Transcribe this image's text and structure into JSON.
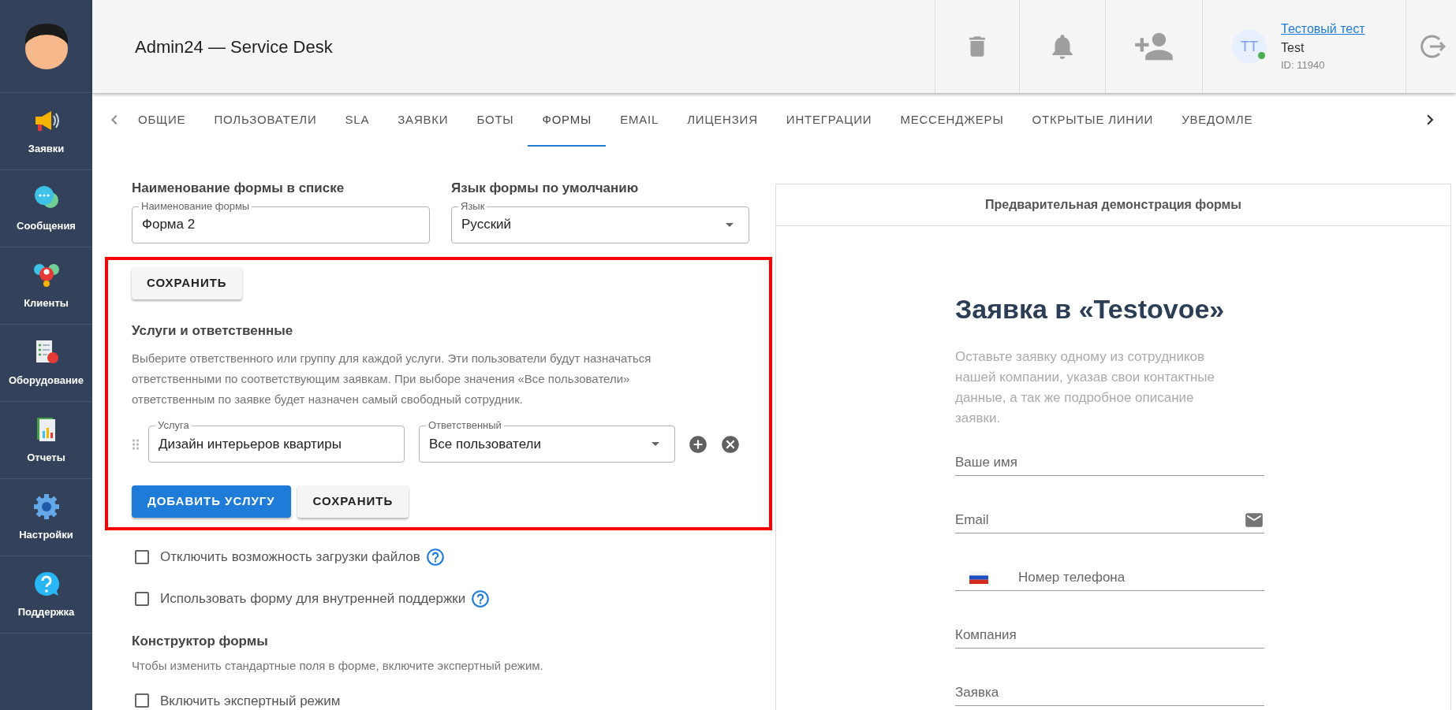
{
  "sidebar": {
    "items": [
      {
        "kind": "megaphone",
        "label": "Заявки"
      },
      {
        "kind": "chat",
        "label": "Сообщения"
      },
      {
        "kind": "clients",
        "label": "Клиенты"
      },
      {
        "kind": "equipment",
        "label": "Оборудование"
      },
      {
        "kind": "reports",
        "label": "Отчеты"
      },
      {
        "kind": "settings",
        "label": "Настройки"
      },
      {
        "kind": "support",
        "label": "Поддержка"
      }
    ]
  },
  "header": {
    "title": "Admin24 — Service Desk",
    "user": {
      "initials": "ТТ",
      "name": "Тестовый тест",
      "login": "Test",
      "id": "ID: 11940",
      "online": true
    }
  },
  "tabs": [
    {
      "label": "ОБЩИЕ",
      "selected": false
    },
    {
      "label": "ПОЛЬЗОВАТЕЛИ",
      "selected": false
    },
    {
      "label": "SLA",
      "selected": false
    },
    {
      "label": "ЗАЯВКИ",
      "selected": false
    },
    {
      "label": "БОТЫ",
      "selected": false
    },
    {
      "label": "ФОРМЫ",
      "selected": true
    },
    {
      "label": "EMAIL",
      "selected": false
    },
    {
      "label": "ЛИЦЕНЗИЯ",
      "selected": false
    },
    {
      "label": "ИНТЕГРАЦИИ",
      "selected": false
    },
    {
      "label": "МЕССЕНДЖЕРЫ",
      "selected": false
    },
    {
      "label": "ОТКРЫТЫЕ ЛИНИИ",
      "selected": false
    },
    {
      "label": "УВЕДОМЛЕ",
      "selected": false
    }
  ],
  "form_name": {
    "heading": "Наименование формы в списке",
    "label": "Наименование формы",
    "value": "Форма 2"
  },
  "language": {
    "heading": "Язык формы по умолчанию",
    "label": "Язык",
    "value": "Русский"
  },
  "save_button": "СОХРАНИТЬ",
  "services": {
    "heading": "Услуги и ответственные",
    "description": "Выберите ответственного или группу для каждой услуги. Эти пользователи будут назначаться ответственными по соответствующим заявкам. При выборе значения «Все пользователи» ответственным по заявке будет назначен самый свободный сотрудник.",
    "rows": [
      {
        "service_label": "Услуга",
        "service": "Дизайн интерьеров квартиры",
        "assignee_label": "Ответственный",
        "assignee": "Все пользователи"
      }
    ],
    "add_button": "ДОБАВИТЬ УСЛУГУ",
    "save_button": "СОХРАНИТЬ"
  },
  "options": [
    {
      "label": "Отключить возможность загрузки файлов",
      "checked": false,
      "help": true
    },
    {
      "label": "Использовать форму для внутренней поддержки",
      "checked": false,
      "help": true
    }
  ],
  "constructor": {
    "heading": "Конструктор формы",
    "description": "Чтобы изменить стандартные поля в форме, включите экспертный режим.",
    "expert": {
      "label": "Включить экспертный режим",
      "checked": false
    }
  },
  "preview": {
    "title": "Предварительная демонстрация формы",
    "heading": "Заявка в «Testovoe»",
    "description": "Оставьте заявку одному из сотрудников нашей компании, указав свои контактные данные, а так же подробное описание заявки.",
    "fields": [
      {
        "kind": "text",
        "placeholder": "Ваше имя"
      },
      {
        "kind": "email",
        "placeholder": "Email"
      },
      {
        "kind": "phone",
        "placeholder": "Номер телефона"
      },
      {
        "kind": "text",
        "placeholder": "Компания"
      },
      {
        "kind": "text",
        "placeholder": "Заявка"
      }
    ]
  }
}
